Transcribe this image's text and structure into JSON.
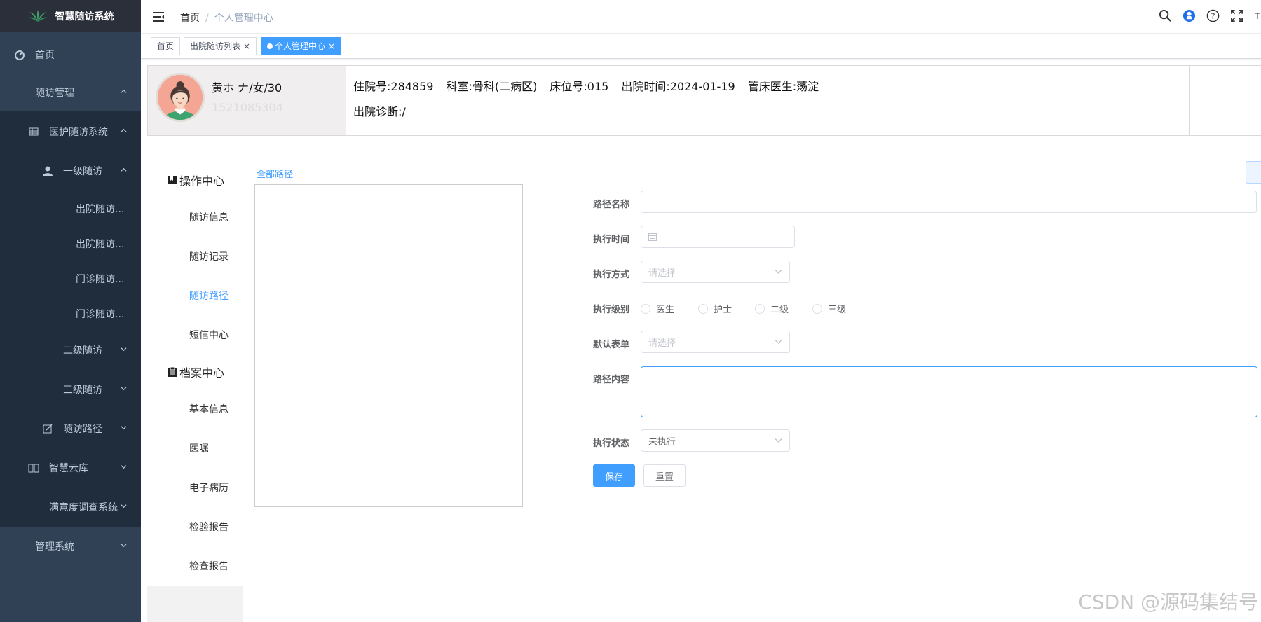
{
  "app": {
    "title": "智慧随访系统",
    "colors": {
      "sidebar_bg": "#304156",
      "sidebar_sub_bg": "#1f2d3d",
      "accent": "#409eff"
    }
  },
  "sidebar": {
    "items": [
      {
        "label": "首页",
        "icon": "dashboard-icon"
      },
      {
        "label": "随访管理"
      },
      {
        "label": "医护随访系统",
        "icon": "table-icon"
      },
      {
        "label": "一级随访",
        "icon": "user-icon"
      },
      {
        "label": "出院随访..."
      },
      {
        "label": "出院随访..."
      },
      {
        "label": "门诊随访..."
      },
      {
        "label": "门诊随访..."
      },
      {
        "label": "二级随访"
      },
      {
        "label": "三级随访"
      },
      {
        "label": "随访路径",
        "icon": "edit-icon"
      },
      {
        "label": "智慧云库",
        "icon": "book-icon"
      },
      {
        "label": "满意度调查系统"
      },
      {
        "label": "管理系统"
      }
    ]
  },
  "navbar": {
    "breadcrumb": [
      "首页",
      "/",
      "个人管理中心"
    ],
    "icons": [
      "search-icon",
      "github-icon",
      "question-icon",
      "fullscreen-icon",
      "size-icon"
    ]
  },
  "tags": [
    {
      "label": "首页"
    },
    {
      "label": "出院随访列表"
    },
    {
      "label": "个人管理中心"
    }
  ],
  "patient": {
    "name_line": "黄ホ 𠂇/女/30",
    "phone": "1521085304",
    "info": [
      "住院号:284859",
      "科室:骨科(二病区)",
      "床位号:015",
      "出院时间:2024-01-19",
      "管床医生:荡淀"
    ],
    "diagnosis": "出院诊断:/"
  },
  "submenu": {
    "head1": "操作中心",
    "items1": [
      "随访信息",
      "随访记录",
      "随访路径",
      "短信中心"
    ],
    "head2": "档案中心",
    "items2": [
      "基本信息",
      "医嘱",
      "电子病历",
      "检验报告",
      "检查报告"
    ]
  },
  "tree": {
    "title": "全部路径"
  },
  "form": {
    "labels": [
      "路径名称",
      "执行时间",
      "执行方式",
      "执行级别",
      "默认表单",
      "路径内容",
      "执行状态"
    ],
    "method_placeholder": "请选择",
    "form_placeholder": "请选择",
    "radios": [
      "医生",
      "护士",
      "二级",
      "三级"
    ],
    "status_value": "未执行",
    "save": "保存",
    "reset": "重置"
  },
  "watermark": "CSDN @源码集结号"
}
